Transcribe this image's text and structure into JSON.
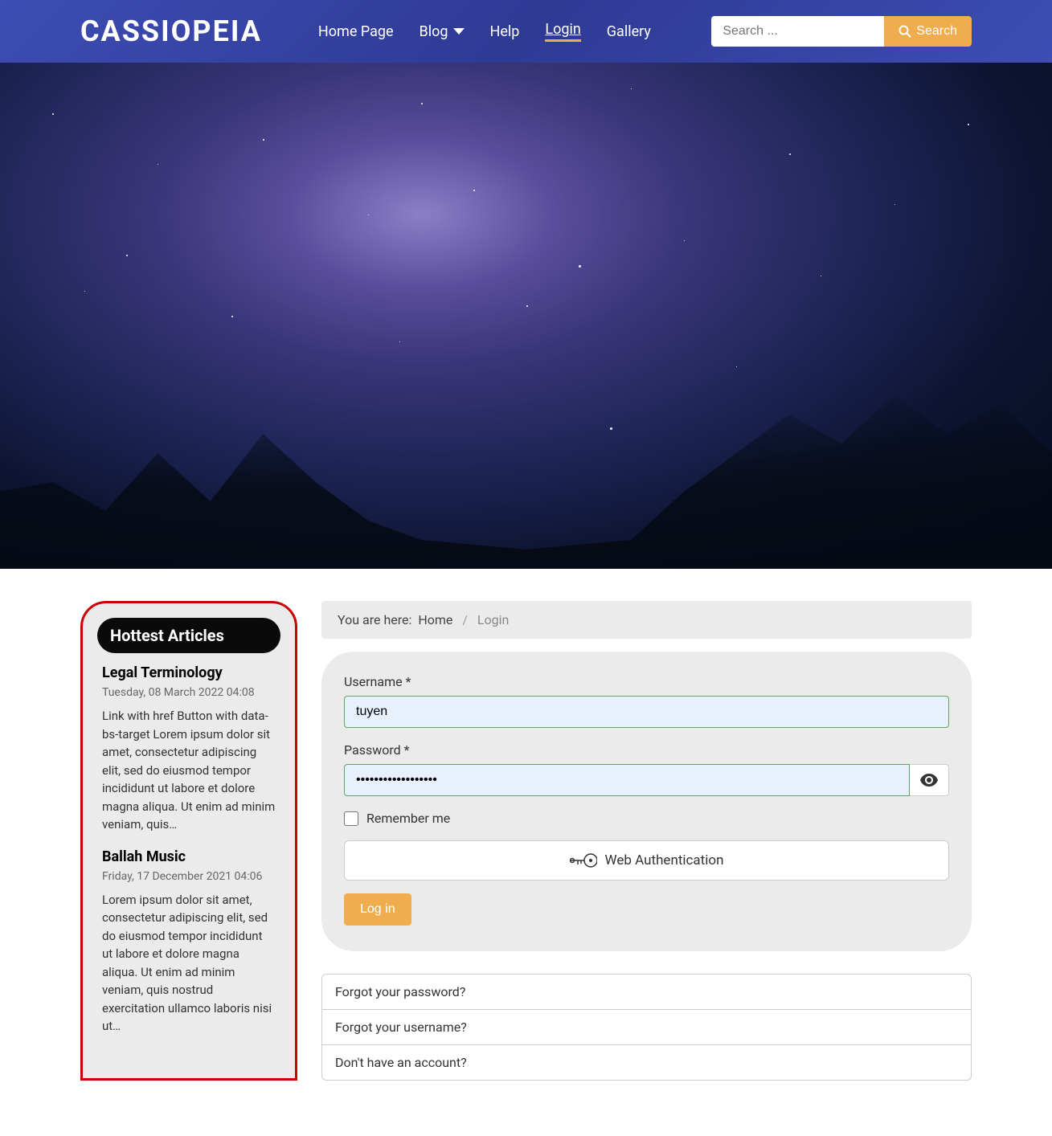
{
  "header": {
    "logo": "CASSIOPEIA",
    "nav": [
      "Home Page",
      "Blog",
      "Help",
      "Login",
      "Gallery"
    ],
    "search_placeholder": "Search ...",
    "search_button": "Search"
  },
  "sidebar": {
    "title": "Hottest Articles",
    "articles": [
      {
        "title": "Legal Terminology",
        "date": "Tuesday, 08 March 2022 04:08",
        "body": "Link with href Button with data-bs-target Lorem ipsum dolor sit amet, consectetur adipiscing elit, sed do eiusmod tempor incididunt ut labore et dolore magna aliqua. Ut enim ad minim veniam, quis…"
      },
      {
        "title": "Ballah Music",
        "date": "Friday, 17 December 2021 04:06",
        "body": "Lorem ipsum dolor sit amet, consectetur adipiscing elit, sed do eiusmod tempor incididunt ut labore et dolore magna aliqua. Ut enim ad minim veniam, quis nostrud exercitation ullamco laboris nisi ut…"
      }
    ]
  },
  "breadcrumb": {
    "prefix": "You are here:",
    "home": "Home",
    "current": "Login"
  },
  "login": {
    "username_label": "Username *",
    "username_value": "tuyen",
    "password_label": "Password *",
    "password_value": "••••••••••••••••••",
    "remember_label": "Remember me",
    "webauthn_label": "Web Authentication",
    "submit_label": "Log in"
  },
  "links": [
    "Forgot your password?",
    "Forgot your username?",
    "Don't have an account?"
  ]
}
